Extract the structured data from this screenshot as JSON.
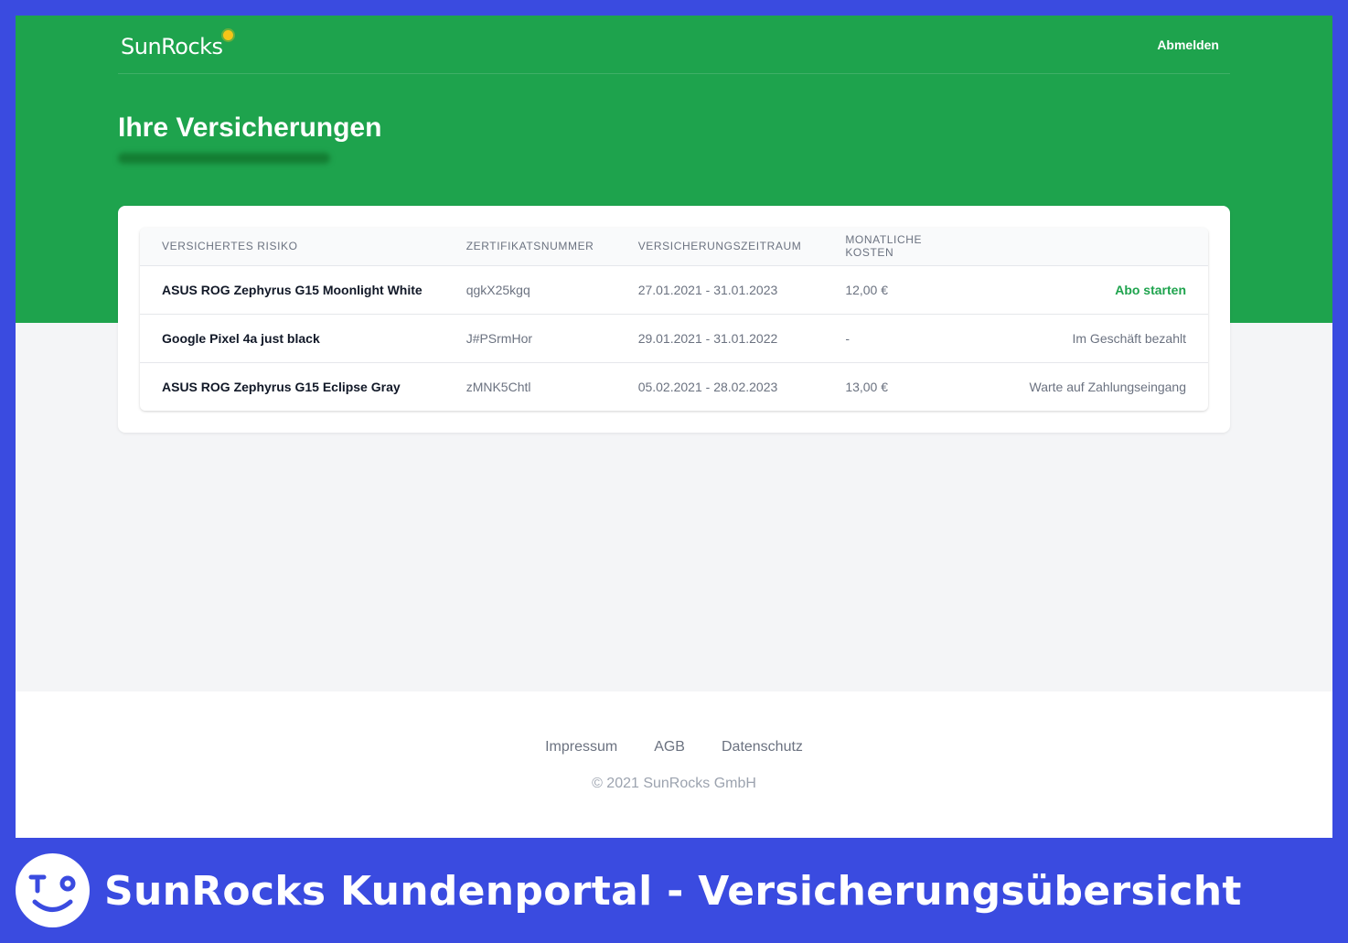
{
  "header": {
    "logo_text": "SunRocks",
    "logout_label": "Abmelden"
  },
  "page": {
    "title": "Ihre Versicherungen"
  },
  "table": {
    "columns": [
      "Versichertes Risiko",
      "Zertifikatsnummer",
      "Versicherungszeitraum",
      "Monatliche Kosten",
      ""
    ],
    "rows": [
      {
        "risk": "ASUS ROG Zephyrus G15 Moonlight White",
        "cert": "qgkX25kgq",
        "period": "27.01.2021 - 31.01.2023",
        "cost": "12,00 €",
        "status": "Abo starten"
      },
      {
        "risk": "Google Pixel 4a just black",
        "cert": "J#PSrmHor",
        "period": "29.01.2021 - 31.01.2022",
        "cost": "-",
        "status": "Im Geschäft bezahlt"
      },
      {
        "risk": "ASUS ROG Zephyrus G15 Eclipse Gray",
        "cert": "zMNK5Chtl",
        "period": "05.02.2021 - 28.02.2023",
        "cost": "13,00 €",
        "status": "Warte auf Zahlungseingang"
      }
    ]
  },
  "footer": {
    "links": [
      "Impressum",
      "AGB",
      "Datenschutz"
    ],
    "copyright": "© 2021 SunRocks GmbH"
  },
  "caption": {
    "title": "SunRocks Kundenportal - Versicherungsübersicht"
  },
  "colors": {
    "brand_green": "#1ea34d",
    "frame_blue": "#3a4be0"
  },
  "icons": {
    "logo_sun": "sun-icon",
    "caption_badge": "smiley-face-icon"
  }
}
